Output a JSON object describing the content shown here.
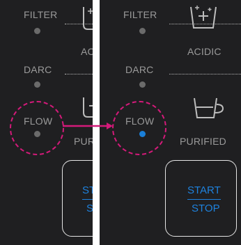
{
  "before_panel": {
    "filter_label": "FILTER",
    "darc_label": "DARC",
    "flow_label": "FLOW",
    "acidic_label_partial": "ACI",
    "purified_label_partial": "PURI",
    "start_label_partial": "STA",
    "stop_label_partial": "ST",
    "flow_indicator_active": false
  },
  "after_panel": {
    "filter_label": "FILTER",
    "darc_label": "DARC",
    "flow_label": "FLOW",
    "acidic_label": "ACIDIC",
    "purified_label": "PURIFIED",
    "start_label": "START",
    "stop_label": "STOP",
    "flow_indicator_active": true
  },
  "colors": {
    "panel_background": "#1f1f21",
    "inactive_indicator": "#6b6b6b",
    "active_indicator": "#1a7fd8",
    "highlight_circle": "#d41a7a",
    "start_stop_text": "#1e82de"
  }
}
